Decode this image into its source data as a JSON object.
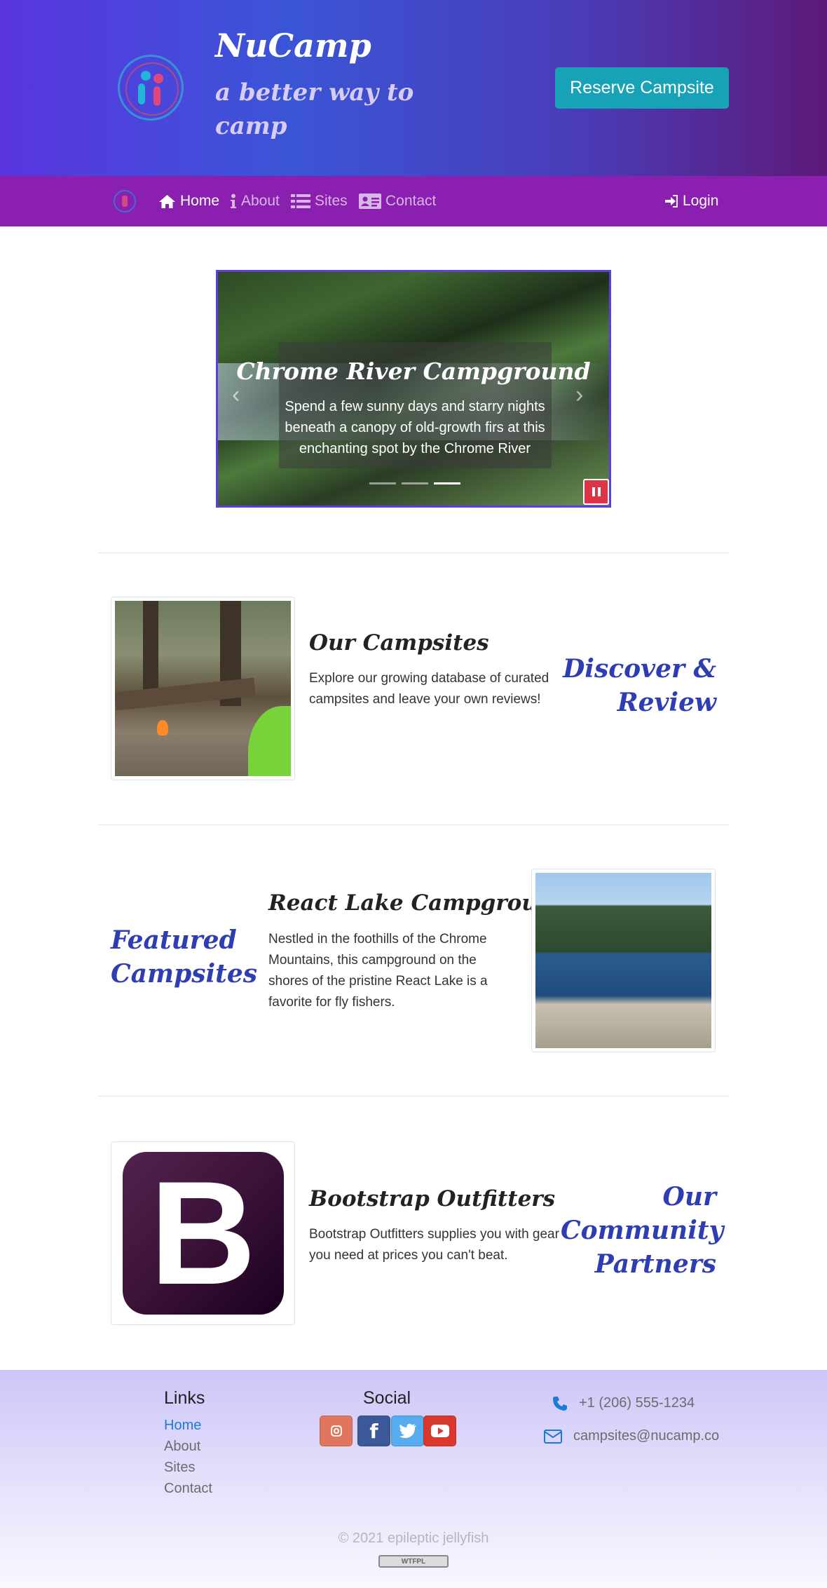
{
  "header": {
    "brand": "NuCamp",
    "tagline": "a better way to camp",
    "reserve_label": "Reserve Campsite",
    "logo_icon": "nucamp-logo-icon"
  },
  "nav": {
    "items": [
      {
        "label": "Home",
        "icon": "home-icon",
        "active": true
      },
      {
        "label": "About",
        "icon": "info-icon",
        "active": false
      },
      {
        "label": "Sites",
        "icon": "list-icon",
        "active": false
      },
      {
        "label": "Contact",
        "icon": "address-card-icon",
        "active": false
      }
    ],
    "login_label": "Login"
  },
  "carousel": {
    "title": "Chrome River Campground",
    "text": "Spend a few sunny days and starry nights beneath a canopy of old-growth firs at this enchanting spot by the Chrome River",
    "slide_count": 3,
    "active_slide": 3
  },
  "sections": [
    {
      "title": "Our Campsites",
      "text": "Explore our growing database of curated campsites and leave your own reviews!",
      "side": "Discover & Review"
    },
    {
      "title": "React Lake Campground",
      "text": "Nestled in the foothills of the Chrome Mountains, this campground on the shores of the pristine React Lake is a favorite for fly fishers.",
      "side": "Featured Campsites"
    },
    {
      "title": "Bootstrap Outfitters",
      "text": "Bootstrap Outfitters supplies you with gear you need at prices you can't beat.",
      "side": "Our Community Partners",
      "logo_letter": "B"
    }
  ],
  "footer": {
    "links_heading": "Links",
    "links": [
      "Home",
      "About",
      "Sites",
      "Contact"
    ],
    "social_heading": "Social",
    "social": [
      {
        "name": "instagram-icon",
        "color": "#e1765e",
        "glyph": "◎"
      },
      {
        "name": "facebook-icon",
        "color": "#3b5998",
        "glyph": "f"
      },
      {
        "name": "twitter-icon",
        "color": "#55acee",
        "glyph": "🐦"
      },
      {
        "name": "youtube-icon",
        "color": "#d9382c",
        "glyph": "▶"
      }
    ],
    "phone": "+1 (206) 555-1234",
    "email": "campsites@nucamp.co",
    "copyright": "©  2021 epileptic jellyfish",
    "license": "WTFPL"
  },
  "colors": {
    "navbar": "#8a1fb0",
    "reserve_button": "#17a2b8",
    "heading_accent": "#2f3db2",
    "pause_button": "#dc3545"
  }
}
